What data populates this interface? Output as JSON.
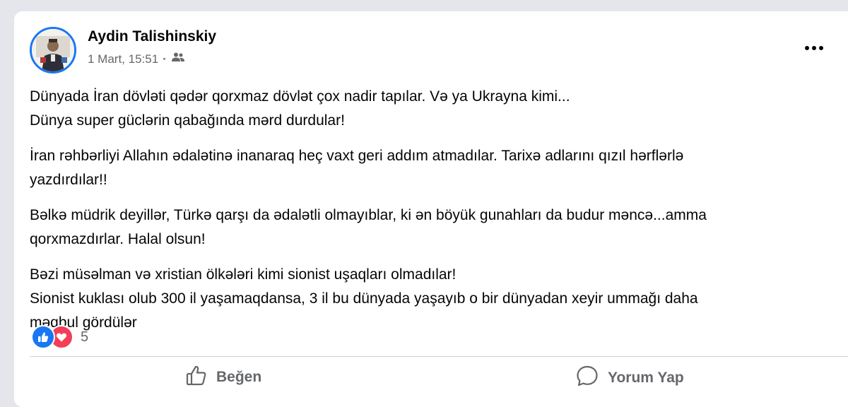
{
  "post": {
    "author": "Aydin Talishinskiy",
    "date": "1 Mart, 15:51",
    "separator": "·",
    "audience_icon": "friends-icon",
    "paragraphs": [
      [
        "Dünyada İran dövləti qədər qorxmaz dövlət çox nadir tapılar. Və ya Ukrayna kimi...",
        "Dünya super güclərin qabağında mərd durdular!"
      ],
      [
        "İran rəhbərliyi Allahın ədalətinə inanaraq heç vaxt geri addım atmadılar. Tarixə adlarını qızıl hərflərlə",
        "yazdırdılar!!"
      ],
      [
        "Bəlkə müdrik deyillər, Türkə qarşı da ədalətli olmayıblar, ki ən böyük gunahları da budur məncə...amma",
        "qorxmazdırlar. Halal olsun!"
      ],
      [
        "Bəzi müsəlman və xristian ölkələri kimi sionist uşaqları olmadılar!",
        "Sionist kuklası olub 300 il yaşamaqdansa, 3 il bu dünyada yaşayıb o bir dünyadan xeyir ummağı daha",
        "məqbul gördülər"
      ]
    ]
  },
  "reactions": {
    "icons": [
      "like-icon",
      "love-icon"
    ],
    "count": "5"
  },
  "actions": {
    "like_label": "Beğen",
    "comment_label": "Yorum Yap"
  },
  "colors": {
    "accent": "#1877f2",
    "love": "#f33e58",
    "secondary_text": "#65676b"
  }
}
